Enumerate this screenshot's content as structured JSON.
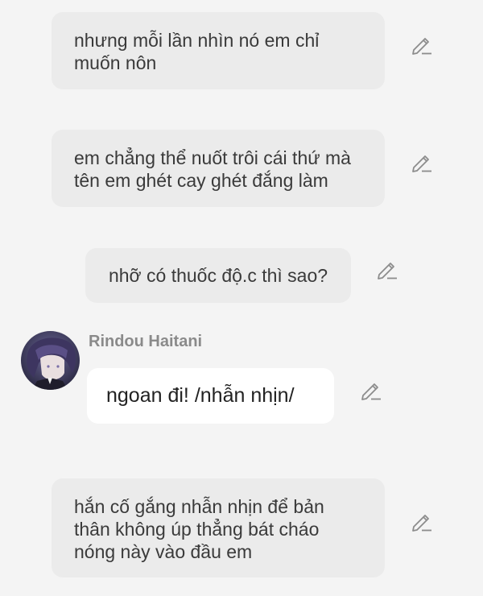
{
  "messages": {
    "m1": {
      "text": "nhưng mỗi lần nhìn nó em chỉ muốn nôn",
      "icon": "pencil-edit-icon"
    },
    "m2": {
      "text": "em chẳng thể nuốt trôi cái thứ mà tên em ghét cay ghét đắng làm",
      "icon": "pencil-edit-icon"
    },
    "m3": {
      "text": "nhỡ có thuốc độ.c thì sao?",
      "icon": "pencil-edit-icon"
    },
    "m4": {
      "speaker": "Rindou Haitani",
      "text": "ngoan đi! /nhẫn nhịn/",
      "avatar": "character-avatar",
      "icon": "pencil-edit-icon"
    },
    "m5": {
      "text": "hắn cố gắng nhẫn nhịn để bản thân không úp thẳng bát cháo nóng này vào đầu em",
      "icon": "pencil-edit-icon"
    }
  },
  "colors": {
    "background": "#f4f4f4",
    "narration_bubble": "#ebebeb",
    "speech_bubble": "#ffffff",
    "icon_stroke": "#8c8c8c",
    "speaker_name": "#8a8a8a"
  }
}
